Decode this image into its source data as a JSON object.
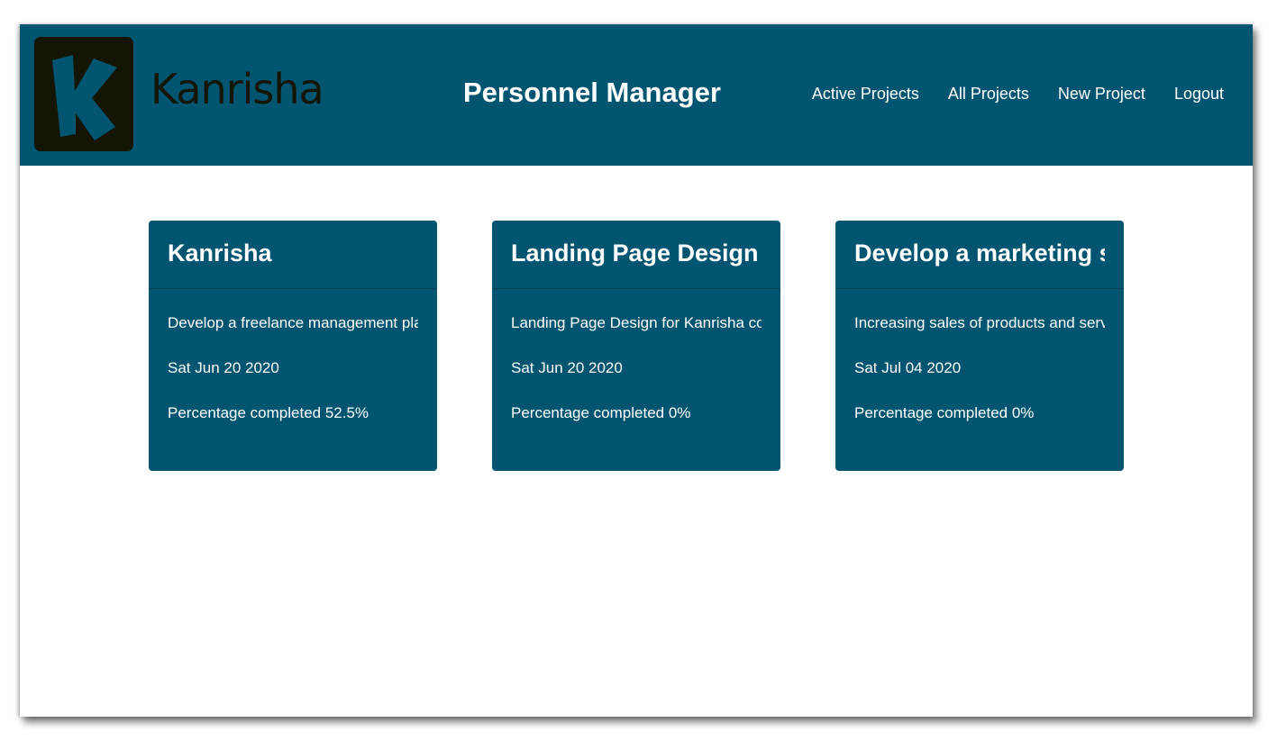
{
  "header": {
    "logo_text": "Kanrisha",
    "title": "Personnel Manager",
    "nav": [
      {
        "label": "Active Projects"
      },
      {
        "label": "All Projects"
      },
      {
        "label": "New Project"
      },
      {
        "label": "Logout"
      }
    ]
  },
  "projects": [
    {
      "title": "Kanrisha",
      "description": "Develop a freelance management pla...",
      "date": "Sat Jun 20 2020",
      "progress_text": "Percentage completed 52.5%"
    },
    {
      "title": "Landing Page Design fo...",
      "description": "Landing Page Design for Kanrisha co...",
      "date": "Sat Jun 20 2020",
      "progress_text": "Percentage completed 0%"
    },
    {
      "title": "Develop a marketing st...",
      "description": "Increasing sales of products and servi...",
      "date": "Sat Jul 04 2020",
      "progress_text": "Percentage completed 0%"
    }
  ],
  "colors": {
    "primary": "#015570",
    "logo_dark": "#141505",
    "text_light": "#ffffff",
    "background": "#ffffff"
  }
}
